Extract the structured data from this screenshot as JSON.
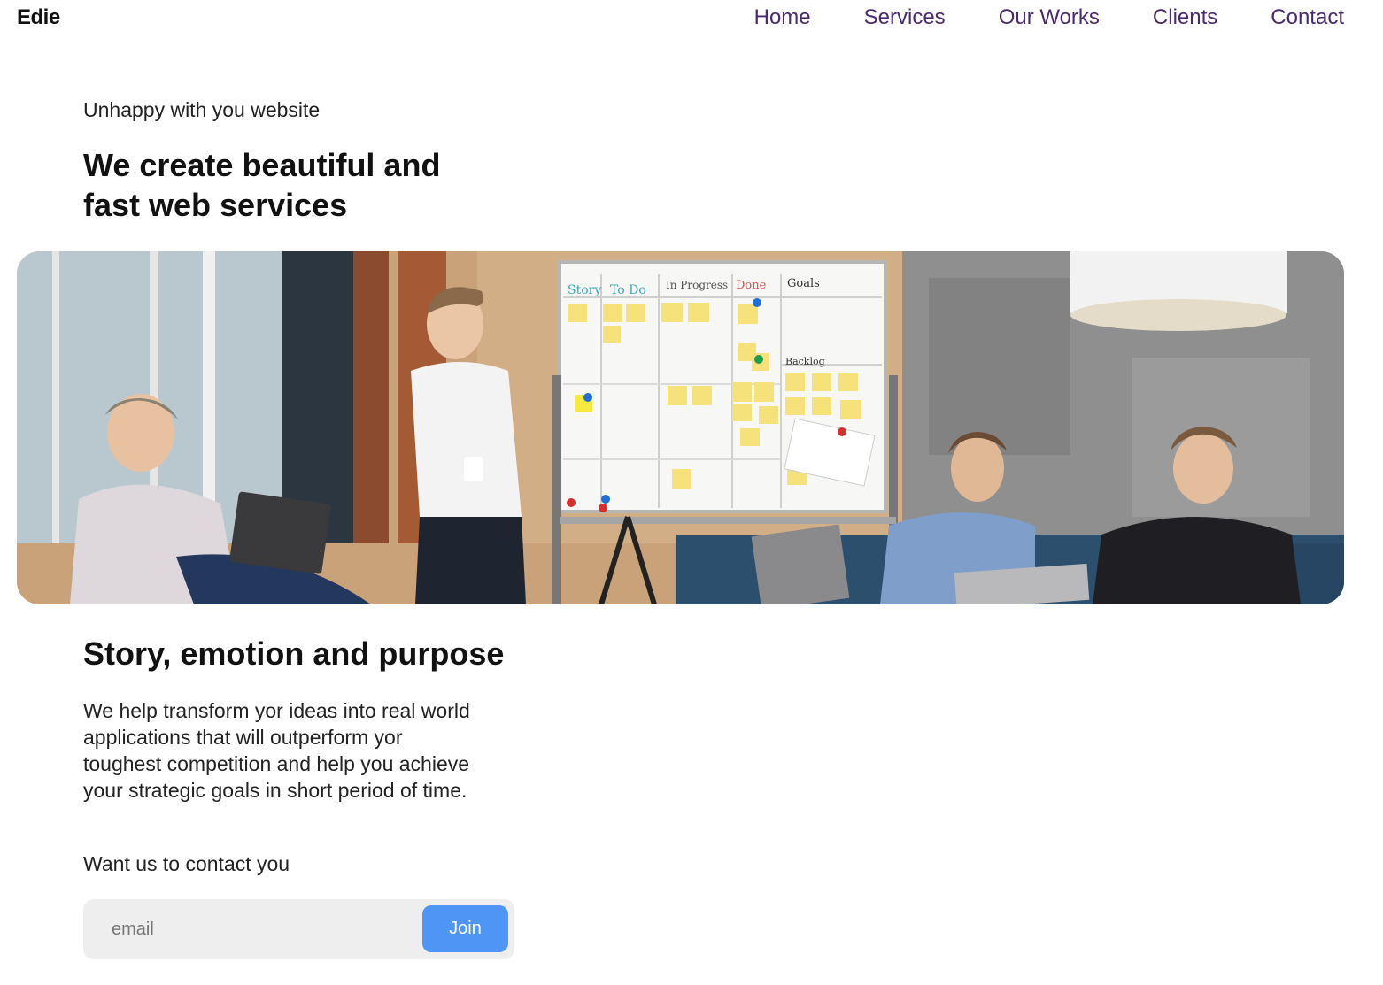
{
  "brand": {
    "logo": "Edie"
  },
  "nav": {
    "items": [
      {
        "label": "Home"
      },
      {
        "label": "Services"
      },
      {
        "label": "Our Works"
      },
      {
        "label": "Clients"
      },
      {
        "label": "Contact"
      }
    ]
  },
  "hero": {
    "subtitle": "Unhappy with you website",
    "title": "We create beautiful and fast web services",
    "image_alt": "team meeting at whiteboard"
  },
  "whiteboard": {
    "columns": [
      "Story",
      "To Do",
      "In Progress",
      "Done",
      "Goals"
    ],
    "backlog_label": "Backlog"
  },
  "about": {
    "title": "Story, emotion and purpose",
    "body": "We help transform yor ideas into real world applications that will outperform yor toughest competition and help you achieve your strategic goals in short period of time."
  },
  "contact": {
    "label": "Want us to contact you",
    "email_placeholder": "email",
    "join_label": "Join"
  },
  "colors": {
    "nav_link": "#4a2a6e",
    "join_button": "#4f95f6",
    "input_bg": "#eeeeee"
  }
}
